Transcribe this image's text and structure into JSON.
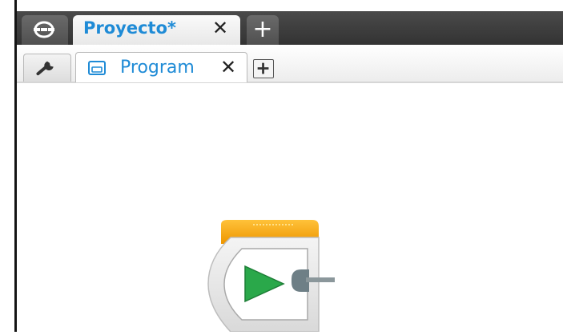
{
  "project_tabs": {
    "home_icon": "home-icon",
    "active_tab_label": "Proyecto*",
    "close_glyph": "✕",
    "add_glyph": "+"
  },
  "program_tabs": {
    "settings_icon": "wrench-icon",
    "active_tab_icon": "program-icon",
    "active_tab_label": "Program",
    "close_glyph": "✕",
    "add_icon": "plus-box-icon"
  },
  "canvas": {
    "blocks": [
      {
        "type": "start-block",
        "icon": "play-icon"
      }
    ]
  },
  "colors": {
    "accent_blue": "#1f8bd6",
    "dark_bar": "#3c3c3c",
    "start_block_top": "#f5a300",
    "play_green": "#2aa84a"
  }
}
